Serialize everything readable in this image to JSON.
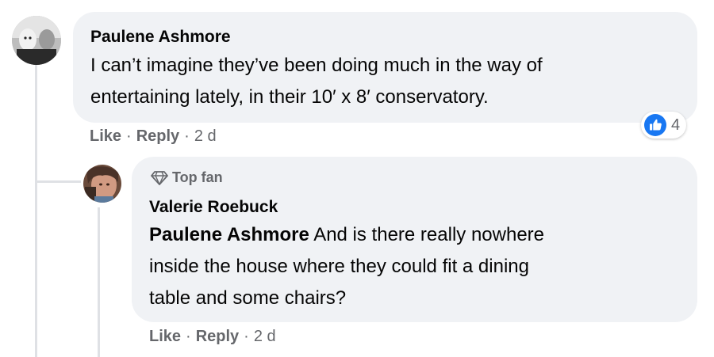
{
  "comment": {
    "author": "Paulene Ashmore",
    "text_line1": "I can’t imagine they’ve been doing much in the way of",
    "text_line2": "entertaining lately, in their 10′ x 8′ conservatory.",
    "actions": {
      "like": "Like",
      "reply": "Reply",
      "time": "2 d"
    },
    "reaction": {
      "icon": "like-icon",
      "count": "4",
      "color": "#1877f2"
    }
  },
  "reply": {
    "badge": {
      "icon": "diamond-icon",
      "label": "Top fan"
    },
    "author": "Valerie Roebuck",
    "mention": "Paulene Ashmore",
    "text_line1": " And is there really nowhere",
    "text_line2": "inside the house where they could fit a dining",
    "text_line3": "table and some chairs?",
    "actions": {
      "like": "Like",
      "reply": "Reply",
      "time": "2 d"
    }
  },
  "colors": {
    "bubble": "#f0f2f5",
    "meta": "#65676b",
    "like_blue": "#1877f2",
    "thread_line": "#dfe1e5"
  }
}
